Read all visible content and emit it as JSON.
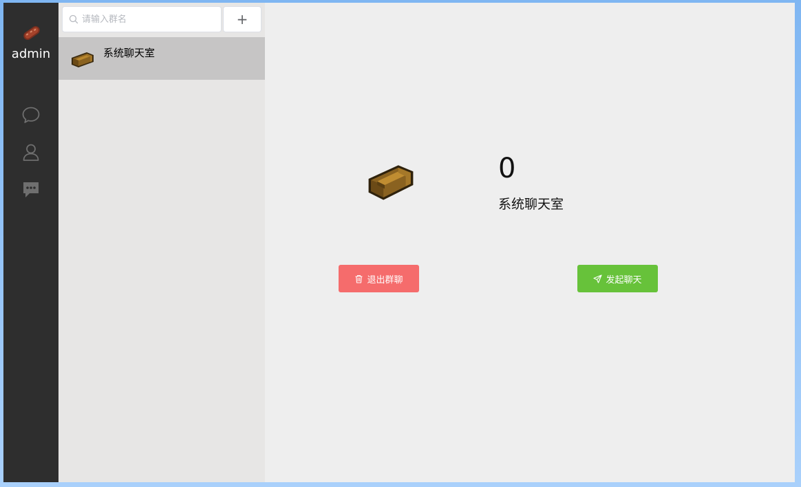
{
  "user": {
    "name": "admin",
    "avatar_icon": "sausage-avatar-icon"
  },
  "nav": {
    "items": [
      {
        "name": "chat-bubble-icon"
      },
      {
        "name": "user-icon"
      },
      {
        "name": "message-dots-icon"
      }
    ]
  },
  "search": {
    "placeholder": "请输入群名",
    "value": ""
  },
  "add_button": {
    "label": "+"
  },
  "groups": [
    {
      "name": "系统聊天室",
      "avatar_icon": "couch-icon"
    }
  ],
  "selected_group": {
    "count": "0",
    "name": "系统聊天室"
  },
  "actions": {
    "quit_label": "退出群聊",
    "chat_label": "发起聊天"
  },
  "colors": {
    "nav_bg": "#2e2e2e",
    "list_bg": "#e7e6e5",
    "selected_bg": "#c6c5c5",
    "danger": "#f56c6c",
    "success": "#67c23a"
  }
}
